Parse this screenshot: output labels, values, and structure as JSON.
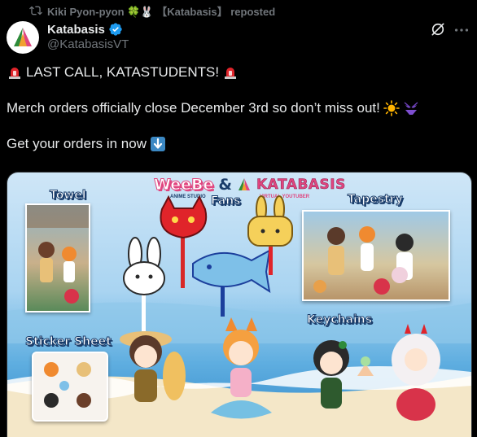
{
  "repost": {
    "text": "Kiki Pyon-pyon 🍀🐰 【Katabasis】 reposted"
  },
  "author": {
    "name": "Katabasis",
    "handle": "@KatabasisVT",
    "verified": true
  },
  "tweet": {
    "line1": "LAST CALL, KATASTUDENTS!",
    "line2": "Merch orders officially close December 3rd so don’t miss out!",
    "line3": "Get your orders in now"
  },
  "media": {
    "brand_left": "WeeBe",
    "brand_left_sub": "ANIME STUDIO",
    "amp": "&",
    "brand_right": "KATABASIS",
    "brand_right_sub": "VIRTUAL YOUTUBER",
    "sections": {
      "towel": "Towel",
      "fans": "Fans",
      "tapestry": "Tapestry",
      "keychains": "Keychains",
      "sticker_sheet": "Sticker Sheet"
    }
  },
  "colors": {
    "background": "#000000",
    "text": "#e7e9ea",
    "muted": "#71767b",
    "verified": "#1d9bf0",
    "label_outline": "#1a3d6b"
  },
  "icons": {
    "repost": "repost-icon",
    "verified": "verified-badge-icon",
    "grok": "grok-icon",
    "more": "more-icon",
    "siren": "rotating-light-icon",
    "sun": "sun-icon",
    "bikini": "bikini-icon",
    "down_arrow": "down-arrow-icon"
  }
}
